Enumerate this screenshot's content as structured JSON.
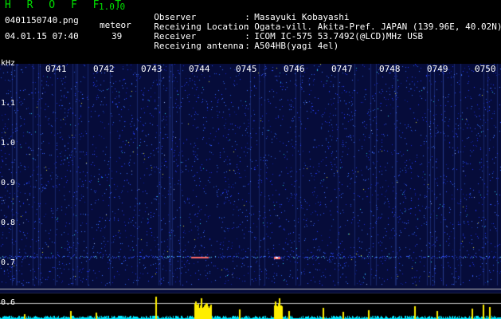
{
  "app": {
    "title": "H R O F F T",
    "version": "1.0.0",
    "file_name": "0401150740.png",
    "datetime": "04.01.15 07:40",
    "meteor_label": "meteor",
    "meteor_count": "39"
  },
  "info": [
    {
      "label": "Observer",
      "value": "Masayuki Kobayashi"
    },
    {
      "label": "Receiving Location",
      "value": "Ogata-vill. Akita-Pref. JAPAN (139.96E, 40.02N)"
    },
    {
      "label": "Receiver",
      "value": "ICOM IC-575 53.7492(@LCD)MHz USB"
    },
    {
      "label": "Receiving antenna",
      "value": "A504HB(yagi 4el)"
    }
  ],
  "axis": {
    "unit": "kHz",
    "freq_ticks": [
      "1.1",
      "1.0",
      "0.9",
      "0.8",
      "0.7",
      "0.6"
    ],
    "time_ticks": [
      "0741",
      "0742",
      "0743",
      "0744",
      "0745",
      "0746",
      "0747",
      "0748",
      "0749",
      "0750"
    ]
  },
  "colors": {
    "background": "#000000",
    "spectrogram_bg": "#060c3a",
    "noise_blue": "#2a3cff",
    "meteor_trace": "#ff6a6a",
    "activity_yellow": "#ffee00",
    "activity_cyan": "#00e8ff",
    "header_green": "#00e000"
  }
}
